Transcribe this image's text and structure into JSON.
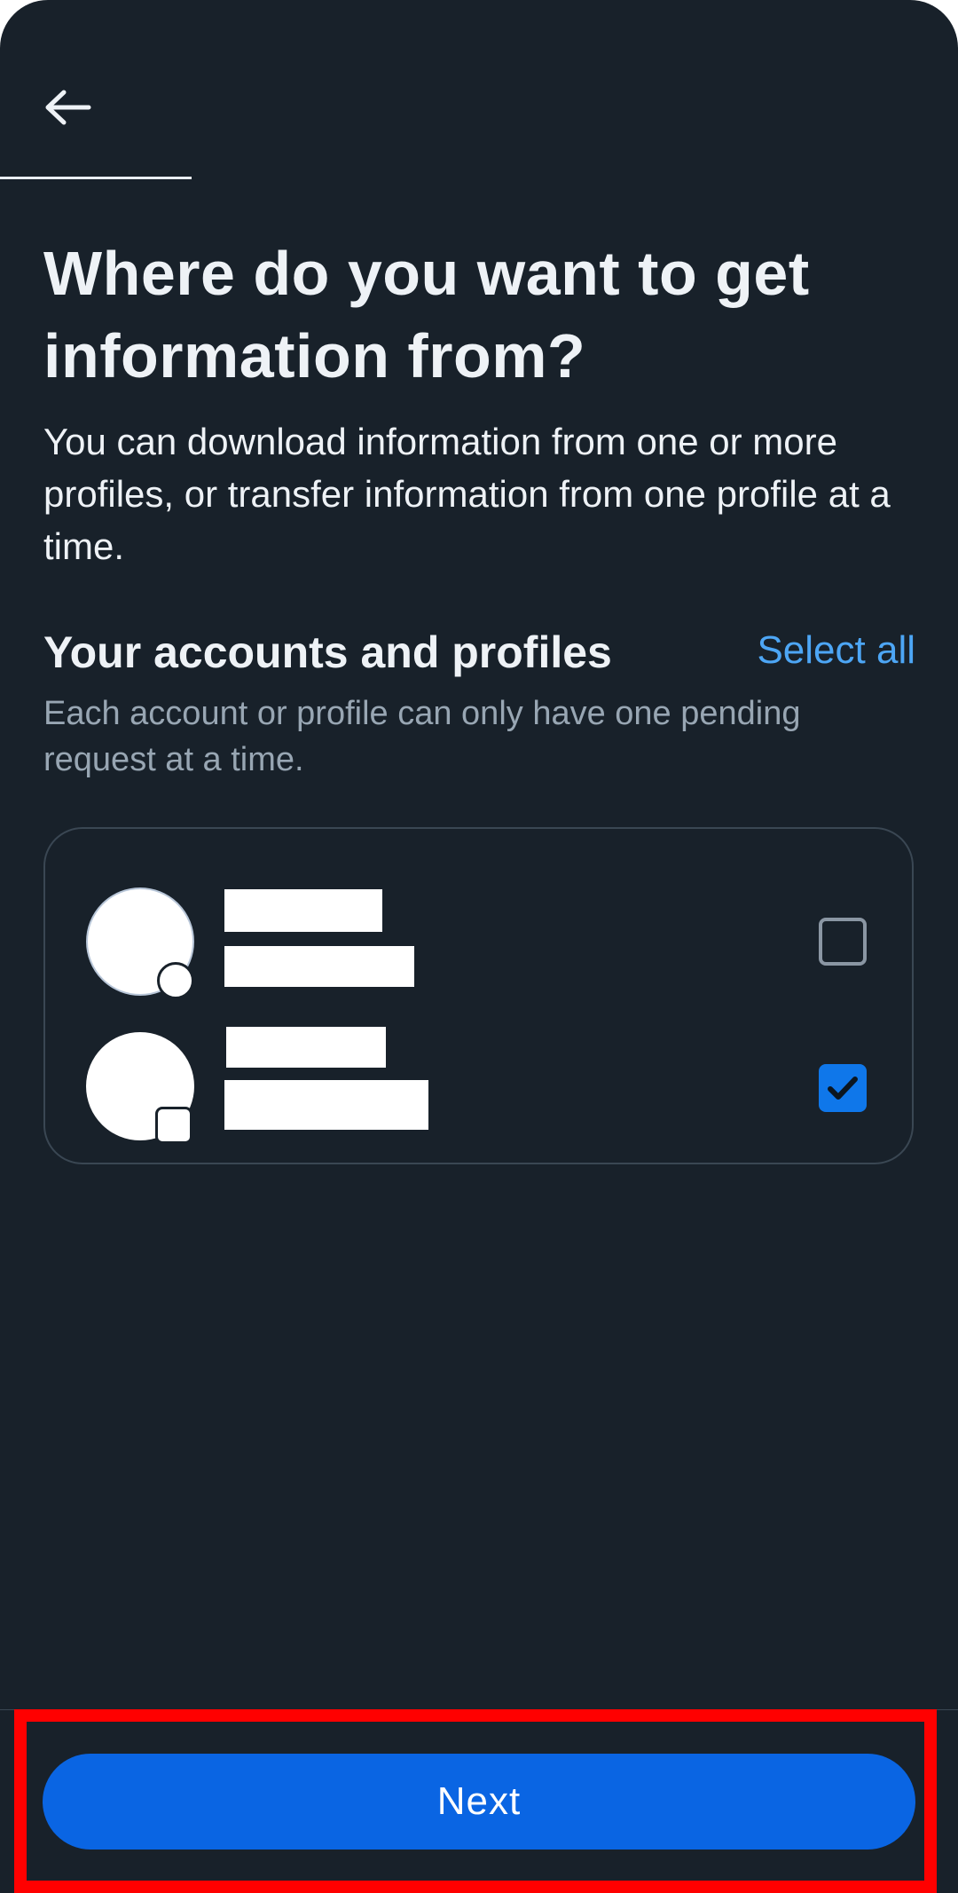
{
  "header": {
    "back_icon": "arrow-left-icon"
  },
  "title": "Where do you want to get information from?",
  "description": "You can download information from one or more profiles, or transfer information from one profile at a time.",
  "accounts_section": {
    "title": "Your accounts and profiles",
    "select_all_label": "Select all",
    "subtitle": "Each account or profile can only have one pending request at a time.",
    "accounts": [
      {
        "checked": false,
        "badge_icon": "facebook-badge-icon"
      },
      {
        "checked": true,
        "badge_icon": "instagram-badge-icon"
      }
    ]
  },
  "footer": {
    "next_label": "Next"
  },
  "colors": {
    "background": "#18212a",
    "accent": "#0a65e3",
    "link": "#4da6f5",
    "highlight": "#ff0000"
  }
}
